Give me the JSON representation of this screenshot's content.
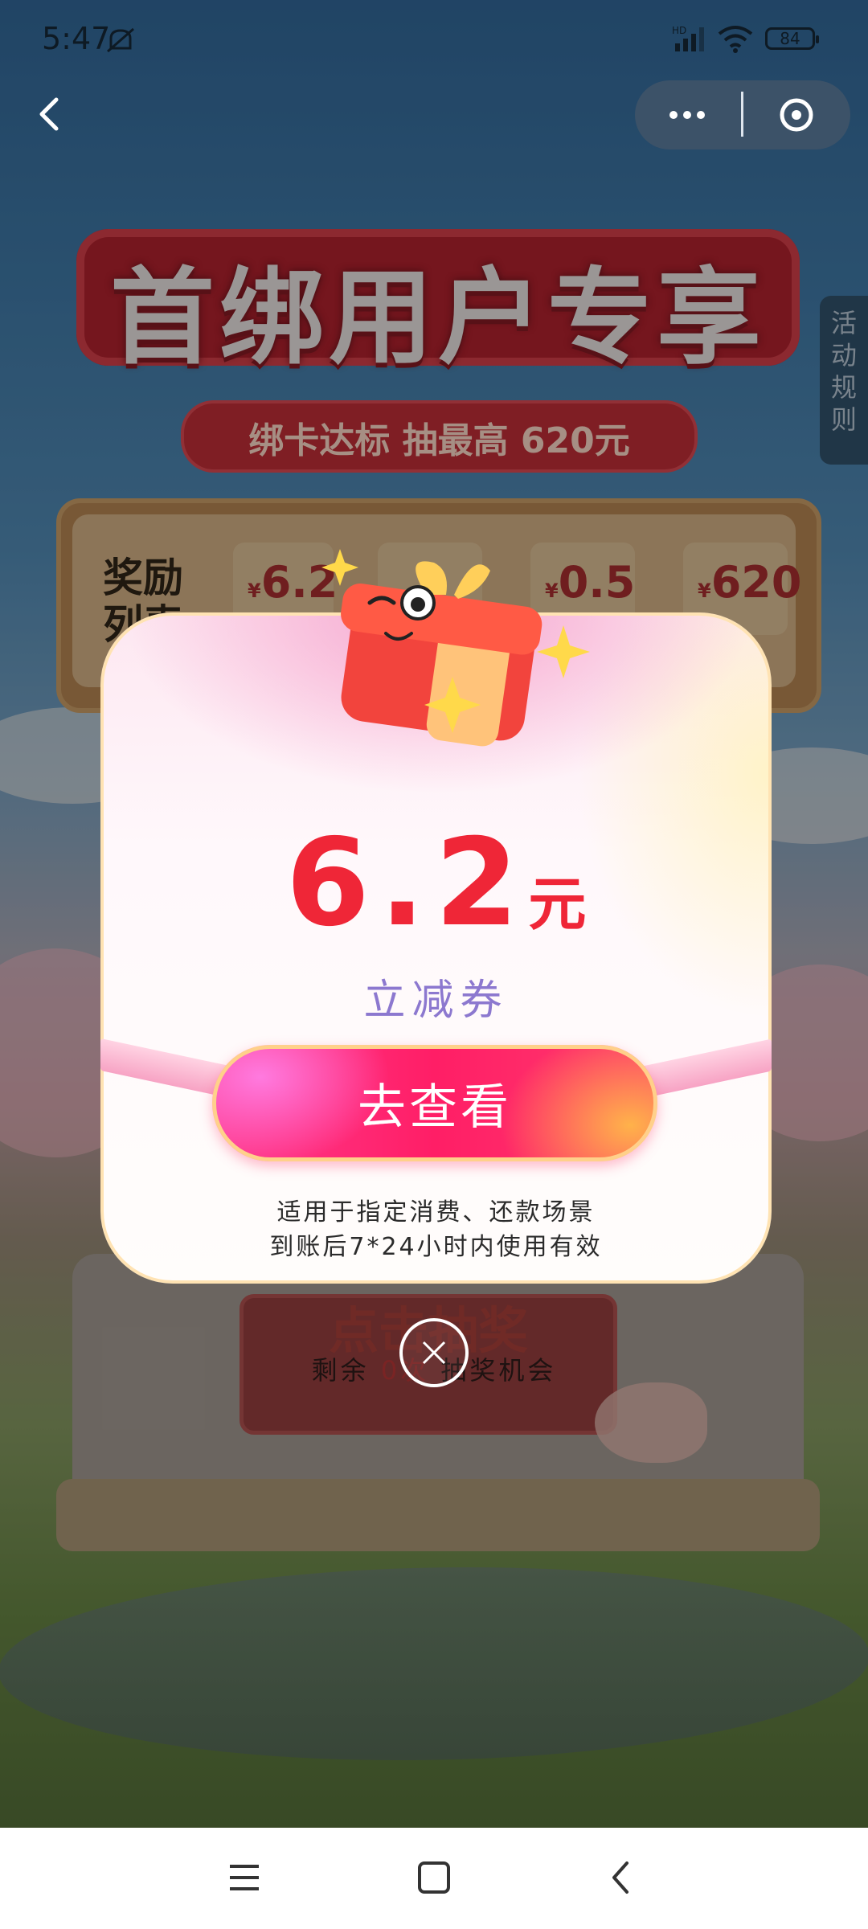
{
  "status_bar": {
    "time": "5:47",
    "battery": "84"
  },
  "background": {
    "main_title": "首绑用户专享",
    "subtitle": "绑卡达标 抽最高 620元",
    "reward_label": "奖励列表",
    "reward_values": [
      "6.2",
      "0.5",
      "620"
    ],
    "currency": "¥",
    "side_tab": "活动规则",
    "draw_button": "点击抽奖",
    "remaining_prefix": "剩余 ",
    "remaining_count": "0次",
    "remaining_suffix": " 抽奖机会"
  },
  "dialog": {
    "amount": "6.2",
    "unit": "元",
    "coupon_type": "立减券",
    "view_button": "去查看",
    "note_line1": "适用于指定消费、还款场景",
    "note_line2": "到账后7*24小时内使用有效"
  },
  "colors": {
    "amount": "#ef2637",
    "coupon_type": "#8c78cf",
    "button_primary": "#ff1e66"
  },
  "icons": {
    "back": "chevron-left-icon",
    "more": "more-dots-icon",
    "close_mini": "close-circle-icon",
    "dismiss": "close-icon",
    "menu": "menu-icon",
    "home": "home-square-icon",
    "nav_back": "chevron-left-icon"
  }
}
